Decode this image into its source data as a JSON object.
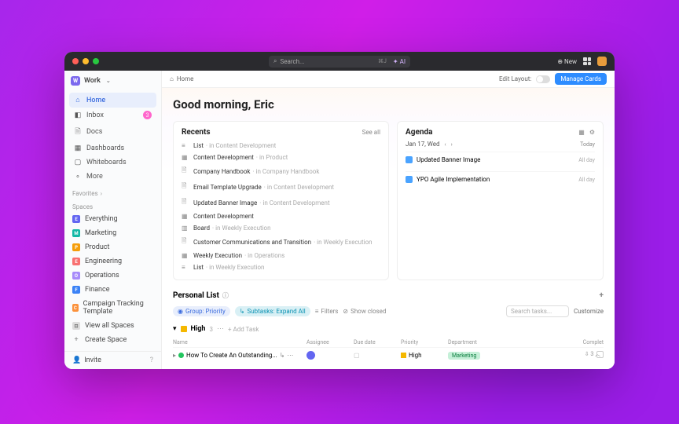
{
  "titlebar": {
    "search_placeholder": "Search...",
    "search_shortcut": "⌘J",
    "ai_label": "✦ AI",
    "new_label": "New"
  },
  "workspace": {
    "icon_letter": "W",
    "name": "Work"
  },
  "nav": {
    "home": "Home",
    "inbox": "Inbox",
    "inbox_badge": "3",
    "docs": "Docs",
    "dashboards": "Dashboards",
    "whiteboards": "Whiteboards",
    "more": "More"
  },
  "sections": {
    "favorites": "Favorites",
    "spaces": "Spaces"
  },
  "spaces": [
    {
      "letter": "E",
      "color": "#6366f1",
      "label": "Everything"
    },
    {
      "letter": "M",
      "color": "#14b8a6",
      "label": "Marketing"
    },
    {
      "letter": "P",
      "color": "#f59e0b",
      "label": "Product"
    },
    {
      "letter": "E",
      "color": "#f87171",
      "label": "Engineering"
    },
    {
      "letter": "O",
      "color": "#a78bfa",
      "label": "Operations"
    },
    {
      "letter": "F",
      "color": "#3b82f6",
      "label": "Finance"
    },
    {
      "letter": "C",
      "color": "#fb923c",
      "label": "Campaign Tracking Template"
    }
  ],
  "space_actions": {
    "view_all": "View all Spaces",
    "create": "Create Space"
  },
  "invite": "Invite",
  "breadcrumb": {
    "home": "Home",
    "edit_layout": "Edit Layout:",
    "manage": "Manage Cards"
  },
  "greeting": "Good morning, Eric",
  "recents": {
    "title": "Recents",
    "see_all": "See all",
    "items": [
      {
        "icon": "≡",
        "name": "List",
        "ctx": "· in Content Development"
      },
      {
        "icon": "▦",
        "name": "Content Development",
        "ctx": "· in Product"
      },
      {
        "icon": "🗎",
        "name": "Company Handbook",
        "ctx": "· in Company Handbook"
      },
      {
        "icon": "🗎",
        "name": "Email Template Upgrade",
        "ctx": "· in Content Development"
      },
      {
        "icon": "🗎",
        "name": "Updated Banner Image",
        "ctx": "· in Content Development"
      },
      {
        "icon": "▦",
        "name": "Content Development",
        "ctx": ""
      },
      {
        "icon": "▥",
        "name": "Board",
        "ctx": "· in Weekly Execution"
      },
      {
        "icon": "🗎",
        "name": "Customer Communications and Transition",
        "ctx": "· in Weekly Execution"
      },
      {
        "icon": "▦",
        "name": "Weekly Execution",
        "ctx": "· in Operations"
      },
      {
        "icon": "≡",
        "name": "List",
        "ctx": "· in Weekly Execution"
      }
    ]
  },
  "agenda": {
    "title": "Agenda",
    "date": "Jan 17, Wed",
    "today": "Today",
    "items": [
      {
        "name": "Updated Banner Image",
        "when": "All day"
      },
      {
        "name": "YPO Agile Implementation",
        "when": "All day"
      }
    ]
  },
  "plist": {
    "title": "Personal List",
    "group_chip": "Group: Priority",
    "sub_chip": "Subtasks: Expand All",
    "filters": "Filters",
    "show_closed": "Show closed",
    "search_placeholder": "Search tasks...",
    "customize": "Customize",
    "group": {
      "name": "High",
      "count": "3",
      "add": "+ Add Task"
    },
    "headers": {
      "name": "Name",
      "assignee": "Assignee",
      "due": "Due date",
      "priority": "Priority",
      "dept": "Department",
      "complete": "Complet"
    },
    "row": {
      "name": "How To Create An Outstanding...",
      "priority": "High",
      "dept": "Marketing"
    },
    "footer": "⇩ 3 ︿"
  }
}
